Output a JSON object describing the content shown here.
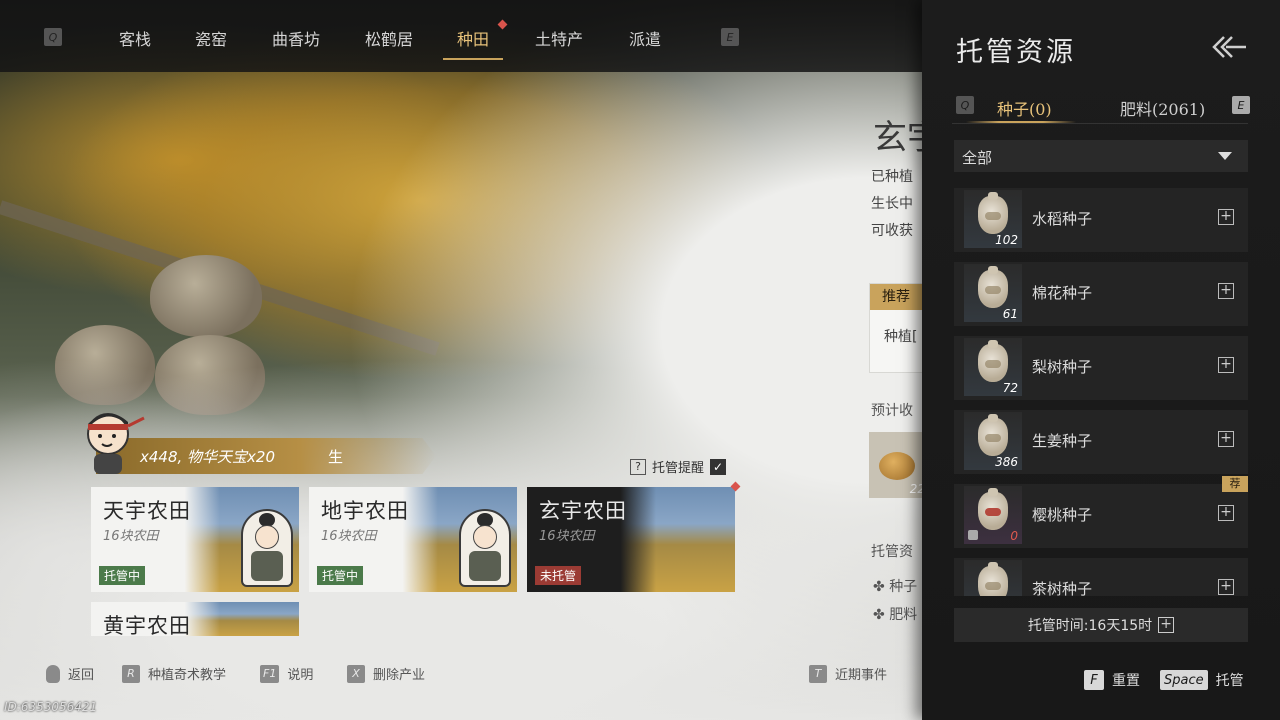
{
  "nav": {
    "q_key": "Q",
    "e_key": "E",
    "tabs": [
      {
        "label": "客栈"
      },
      {
        "label": "瓷窑"
      },
      {
        "label": "曲香坊"
      },
      {
        "label": "松鹤居"
      },
      {
        "label": "种田"
      },
      {
        "label": "土特产"
      },
      {
        "label": "派遣"
      }
    ],
    "active_tab": "种田"
  },
  "info": {
    "title": "玄宇",
    "lines": [
      "已种植",
      "生长中",
      "可收获"
    ],
    "recommend_tag": "推荐",
    "recommend_text": "种植[",
    "predict_label": "预计收",
    "product_count": "22",
    "managed_label": "托管资",
    "managed_items": [
      "种子",
      "肥料"
    ]
  },
  "reward": {
    "text": "x448, 物华天宝x20",
    "suffix": "生"
  },
  "manage_remind": {
    "help": "?",
    "label": "托管提醒",
    "checked": true,
    "check_mark": "✓"
  },
  "farms": [
    {
      "name": "天宇农田",
      "sub": "16块农田",
      "status": "托管中",
      "managed": true
    },
    {
      "name": "地宇农田",
      "sub": "16块农田",
      "status": "托管中",
      "managed": true
    },
    {
      "name": "玄宇农田",
      "sub": "16块农田",
      "status": "未托管",
      "managed": false
    },
    {
      "name": "黄宇农田",
      "sub": "",
      "status": "",
      "managed": true
    }
  ],
  "bottom": {
    "back": "返回",
    "tutorial_key": "R",
    "tutorial": "种植奇术教学",
    "help_key": "F1",
    "help": "说明",
    "delete_key": "X",
    "delete": "删除产业",
    "events_key": "T",
    "events": "近期事件",
    "id_text": "ID:6353056421"
  },
  "panel": {
    "title": "托管资源",
    "tab_q": "Q",
    "tab_e": "E",
    "tab_seeds": "种子(0)",
    "tab_fertilizer": "肥料(2061)",
    "filter": "全部",
    "seeds": [
      {
        "name": "水稻种子",
        "count": "102"
      },
      {
        "name": "棉花种子",
        "count": "61"
      },
      {
        "name": "梨树种子",
        "count": "72"
      },
      {
        "name": "生姜种子",
        "count": "386"
      },
      {
        "name": "樱桃种子",
        "count": "0",
        "recommended": true,
        "rec_label": "荐"
      },
      {
        "name": "茶树种子",
        "count": ""
      }
    ],
    "manage_time": "托管时间:16天15时",
    "reset_key": "F",
    "reset": "重置",
    "manage_key": "Space",
    "manage": "托管"
  },
  "colors": {
    "accent_gold": "#c9a35c",
    "managed_green": "#4b7a4a",
    "unmanaged_red": "#9b3b34",
    "alert_red": "#d9544c"
  }
}
